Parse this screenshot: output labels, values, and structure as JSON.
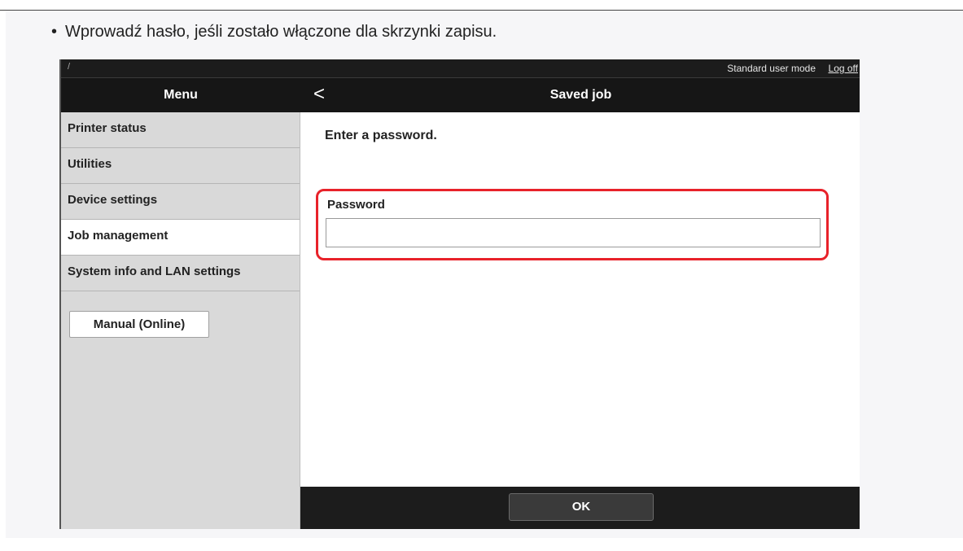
{
  "note": {
    "bullet": "•",
    "text": "Wprowadź hasło, jeśli zostało włączone dla skrzynki zapisu."
  },
  "topbar": {
    "mode": "Standard user mode",
    "logoff": "Log off"
  },
  "header": {
    "menu_title": "Menu",
    "back_glyph": "<",
    "page_title": "Saved job"
  },
  "sidebar": {
    "items": [
      {
        "label": "Printer status",
        "active": false
      },
      {
        "label": "Utilities",
        "active": false
      },
      {
        "label": "Device settings",
        "active": false
      },
      {
        "label": "Job management",
        "active": true
      },
      {
        "label": "System info and LAN settings",
        "active": false
      }
    ],
    "manual_button": "Manual (Online)"
  },
  "content": {
    "instruction": "Enter a password.",
    "password_label": "Password",
    "password_value": ""
  },
  "footer": {
    "ok_label": "OK"
  },
  "colors": {
    "highlight": "#e8222a",
    "header_bg": "#161616",
    "sidebar_bg": "#d9d9d9"
  }
}
